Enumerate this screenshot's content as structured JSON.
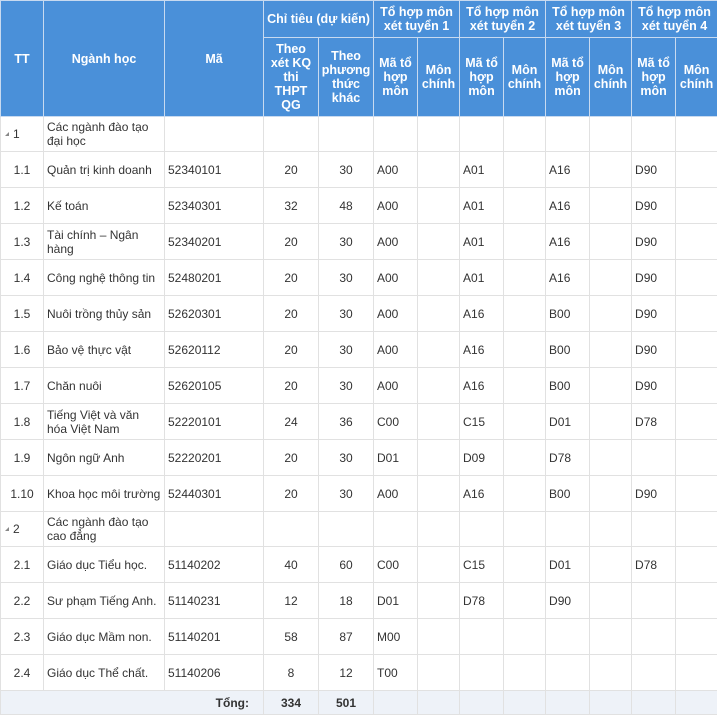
{
  "headers": {
    "tt": "TT",
    "nganh": "Ngành học",
    "ma": "Mã",
    "chitieu": "Chỉ tiêu (dự kiến)",
    "thpt": "Theo xét KQ thi THPT QG",
    "khac": "Theo phương thức khác",
    "tohop1": "Tổ hợp môn xét tuyển 1",
    "tohop2": "Tổ hợp môn xét tuyển 2",
    "tohop3": "Tổ hợp môn xét tuyển 3",
    "tohop4": "Tổ hợp môn xét tuyển 4",
    "ma_to_hop": "Mã tổ hợp môn",
    "mon_chinh": "Môn chính"
  },
  "rows": [
    {
      "type": "section",
      "tt": "1",
      "name": "Các ngành đào tạo đại học"
    },
    {
      "tt": "1.1",
      "name": "Quản trị kinh doanh",
      "code": "52340101",
      "thpt": "20",
      "khac": "30",
      "th1": "A00",
      "th2": "A01",
      "th3": "A16",
      "th4": "D90"
    },
    {
      "tt": "1.2",
      "name": "Kế toán",
      "code": "52340301",
      "thpt": "32",
      "khac": "48",
      "th1": "A00",
      "th2": "A01",
      "th3": "A16",
      "th4": "D90"
    },
    {
      "tt": "1.3",
      "name": "Tài chính – Ngân hàng",
      "code": "52340201",
      "thpt": "20",
      "khac": "30",
      "th1": "A00",
      "th2": "A01",
      "th3": "A16",
      "th4": "D90"
    },
    {
      "tt": "1.4",
      "name": "Công nghệ thông tin",
      "code": "52480201",
      "thpt": "20",
      "khac": "30",
      "th1": "A00",
      "th2": "A01",
      "th3": "A16",
      "th4": "D90"
    },
    {
      "tt": "1.5",
      "name": "Nuôi trồng thủy sản",
      "code": "52620301",
      "thpt": "20",
      "khac": "30",
      "th1": "A00",
      "th2": "A16",
      "th3": "B00",
      "th4": "D90"
    },
    {
      "tt": "1.6",
      "name": "Bảo vệ thực vật",
      "code": "52620112",
      "thpt": "20",
      "khac": "30",
      "th1": "A00",
      "th2": "A16",
      "th3": "B00",
      "th4": "D90"
    },
    {
      "tt": "1.7",
      "name": "Chăn nuôi",
      "code": "52620105",
      "thpt": "20",
      "khac": "30",
      "th1": "A00",
      "th2": "A16",
      "th3": "B00",
      "th4": "D90"
    },
    {
      "tt": "1.8",
      "name": "Tiếng Việt và văn hóa Việt Nam",
      "code": "52220101",
      "thpt": "24",
      "khac": "36",
      "th1": "C00",
      "th2": "C15",
      "th3": "D01",
      "th4": "D78"
    },
    {
      "tt": "1.9",
      "name": "Ngôn ngữ Anh",
      "code": "52220201",
      "thpt": "20",
      "khac": "30",
      "th1": "D01",
      "th2": "D09",
      "th3": "D78",
      "th4": ""
    },
    {
      "tt": "1.10",
      "name": "Khoa học môi trường",
      "code": "52440301",
      "thpt": "20",
      "khac": "30",
      "th1": "A00",
      "th2": "A16",
      "th3": "B00",
      "th4": "D90"
    },
    {
      "type": "section",
      "tt": "2",
      "name": "Các ngành đào tạo cao đẳng"
    },
    {
      "tt": "2.1",
      "name": "Giáo dục Tiểu học.",
      "code": "51140202",
      "thpt": "40",
      "khac": "60",
      "th1": "C00",
      "th2": "C15",
      "th3": "D01",
      "th4": "D78"
    },
    {
      "tt": "2.2",
      "name": "Sư phạm Tiếng Anh.",
      "code": "51140231",
      "thpt": "12",
      "khac": "18",
      "th1": "D01",
      "th2": "D78",
      "th3": "D90",
      "th4": ""
    },
    {
      "tt": "2.3",
      "name": "Giáo dục Mầm non.",
      "code": "51140201",
      "thpt": "58",
      "khac": "87",
      "th1": "M00",
      "th2": "",
      "th3": "",
      "th4": ""
    },
    {
      "tt": "2.4",
      "name": "Giáo dục Thể chất.",
      "code": "51140206",
      "thpt": "8",
      "khac": "12",
      "th1": "T00",
      "th2": "",
      "th3": "",
      "th4": ""
    }
  ],
  "footer": {
    "label": "Tổng:",
    "thpt": "334",
    "khac": "501"
  },
  "colors": {
    "header_bg": "#4a90d9",
    "header_text": "#ffffff",
    "border": "#e1e1e1",
    "footer_bg": "#eef2f8"
  }
}
